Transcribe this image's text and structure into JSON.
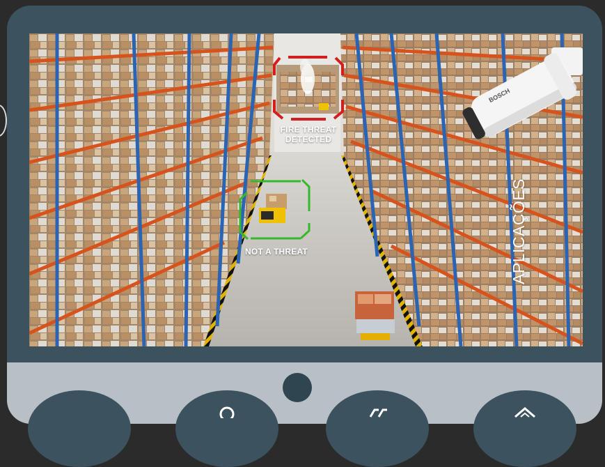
{
  "scene": {
    "fire_label_line1": "FIRE THREAT",
    "fire_label_line2": "DETECTED",
    "not_threat_label": "NOT A THREAT",
    "side_label": "APLICAÇÕES",
    "camera_brand": "BOSCH",
    "fire_box_color": "#d11f1f",
    "safe_box_color": "#35b92a"
  },
  "controls": {
    "buttons": [
      {
        "name": "app-button-1",
        "icon": "circle-icon"
      },
      {
        "name": "app-button-2",
        "icon": "search-icon"
      },
      {
        "name": "app-button-3",
        "icon": "arrows-icon"
      },
      {
        "name": "app-button-4",
        "icon": "home-icon"
      }
    ]
  },
  "colors": {
    "frame": "#3c525e",
    "panel": "#b9c0c5",
    "rack_blue": "#2b64b3",
    "rack_orange": "#d6531d"
  }
}
